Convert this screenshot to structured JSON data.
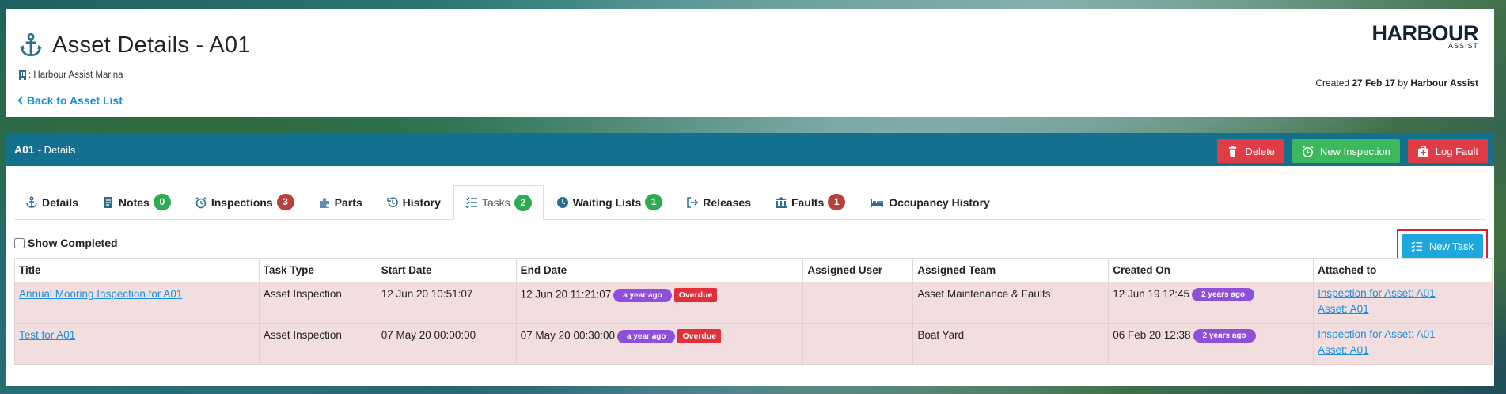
{
  "header": {
    "title": "Asset Details - A01",
    "marina": ": Harbour Assist Marina",
    "back_link": "Back to Asset List",
    "logo_main": "HARBOUR",
    "logo_sub": "ASSIST",
    "created_prefix": "Created ",
    "created_date": "27 Feb 17",
    "created_by_word": " by ",
    "created_by": "Harbour Assist"
  },
  "panel": {
    "asset_code": "A01",
    "title_rest": "- Details",
    "buttons": {
      "delete": "Delete",
      "new_inspection": "New Inspection",
      "log_fault": "Log Fault"
    }
  },
  "tabs": [
    {
      "label": "Details",
      "icon": "anchor-icon"
    },
    {
      "label": "Notes",
      "icon": "note-icon",
      "badge": "0",
      "badge_color": "green"
    },
    {
      "label": "Inspections",
      "icon": "alarm-clock-icon",
      "badge": "3",
      "badge_color": "red"
    },
    {
      "label": "Parts",
      "icon": "puzzle-icon"
    },
    {
      "label": "History",
      "icon": "history-icon"
    },
    {
      "label": "Tasks",
      "icon": "checklist-icon",
      "badge": "2",
      "badge_color": "green",
      "active": true
    },
    {
      "label": "Waiting Lists",
      "icon": "clock-icon",
      "badge": "1",
      "badge_color": "green"
    },
    {
      "label": "Releases",
      "icon": "sign-out-icon"
    },
    {
      "label": "Faults",
      "icon": "bank-icon",
      "badge": "1",
      "badge_color": "red"
    },
    {
      "label": "Occupancy History",
      "icon": "bed-icon"
    }
  ],
  "tasks": {
    "show_completed_label": "Show Completed",
    "new_task_label": "New Task",
    "columns": [
      "Title",
      "Task Type",
      "Start Date",
      "End Date",
      "Assigned User",
      "Assigned Team",
      "Created On",
      "Attached to"
    ],
    "rows": [
      {
        "title": "Annual Mooring Inspection for A01",
        "task_type": "Asset Inspection",
        "start_date": "12 Jun 20 10:51:07",
        "end_date": "12 Jun 20 11:21:07",
        "end_ago": "a year ago",
        "overdue": "Overdue",
        "assigned_user": "",
        "assigned_team": "Asset Maintenance & Faults",
        "created_on": "12 Jun 19 12:45",
        "created_ago": "2 years ago",
        "attached_1": "Inspection for Asset: A01",
        "attached_2": "Asset: A01"
      },
      {
        "title": "Test for A01",
        "task_type": "Asset Inspection",
        "start_date": "07 May 20 00:00:00",
        "end_date": "07 May 20 00:30:00",
        "end_ago": "a year ago",
        "overdue": "Overdue",
        "assigned_user": "",
        "assigned_team": "Boat Yard",
        "created_on": "06 Feb 20 12:38",
        "created_ago": "2 years ago",
        "attached_1": "Inspection for Asset: A01",
        "attached_2": "Asset: A01"
      }
    ]
  },
  "colors": {
    "panel_head": "#14708f",
    "link": "#1a8ee0",
    "danger": "#e03c46",
    "success": "#3bb95c",
    "info": "#1ea7dc",
    "row_overdue": "#f2dede",
    "pill_purple": "#8e4fd9"
  }
}
